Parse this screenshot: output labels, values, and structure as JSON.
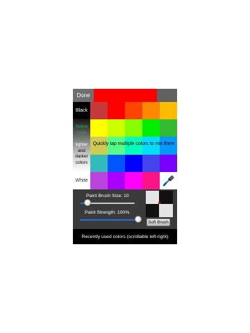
{
  "top_bar": {
    "done_label": "Done",
    "current_color": "#ff0000",
    "previous_color": "#616161"
  },
  "side": {
    "black_label": "Black",
    "swipe_lines": [
      {
        "text": "Swipe",
        "color": "#2aa84a"
      },
      {
        "text": "here",
        "color": "#2aa84a"
      },
      {
        "text": "for",
        "color": "#2aa84a"
      },
      {
        "text": "lighter",
        "color": "#ffffff"
      },
      {
        "text": "and",
        "color": "#000000"
      },
      {
        "text": "darker",
        "color": "#000000"
      },
      {
        "text": "colors",
        "color": "#000000"
      }
    ],
    "white_label": "White"
  },
  "palette": {
    "rows": [
      [
        "#c43a3a",
        "#ff0000",
        "#ff4400",
        "#ff8800",
        "#ffbb00"
      ],
      [
        "#ffff00",
        "#ccff00",
        "#88ff00",
        "#00ee00",
        "#33bb33"
      ],
      [
        "#cccc55",
        "#55ff88",
        "#00ffbb",
        "#00ddff",
        "#0099ff"
      ],
      [
        "#33bbbb",
        "#0055ff",
        "#0000ff",
        "#4444ee",
        "#7700ff"
      ],
      [
        "#bb44dd",
        "#aa00ff",
        "#ff00ff",
        "#ff1188",
        "picker"
      ]
    ],
    "hint": "Quickly tap multiple colors to mix them",
    "picker_icon": "eyedropper-icon"
  },
  "controls": {
    "brush_size_label": "Paint Brush Size: 10",
    "brush_size_fraction": 0.13,
    "strength_label": "Paint Strength: 100%",
    "strength_fraction": 1.0,
    "soft_brush_label": "Soft Brush"
  },
  "recent": {
    "label": "Recently used colors (scrollable left-right)"
  }
}
